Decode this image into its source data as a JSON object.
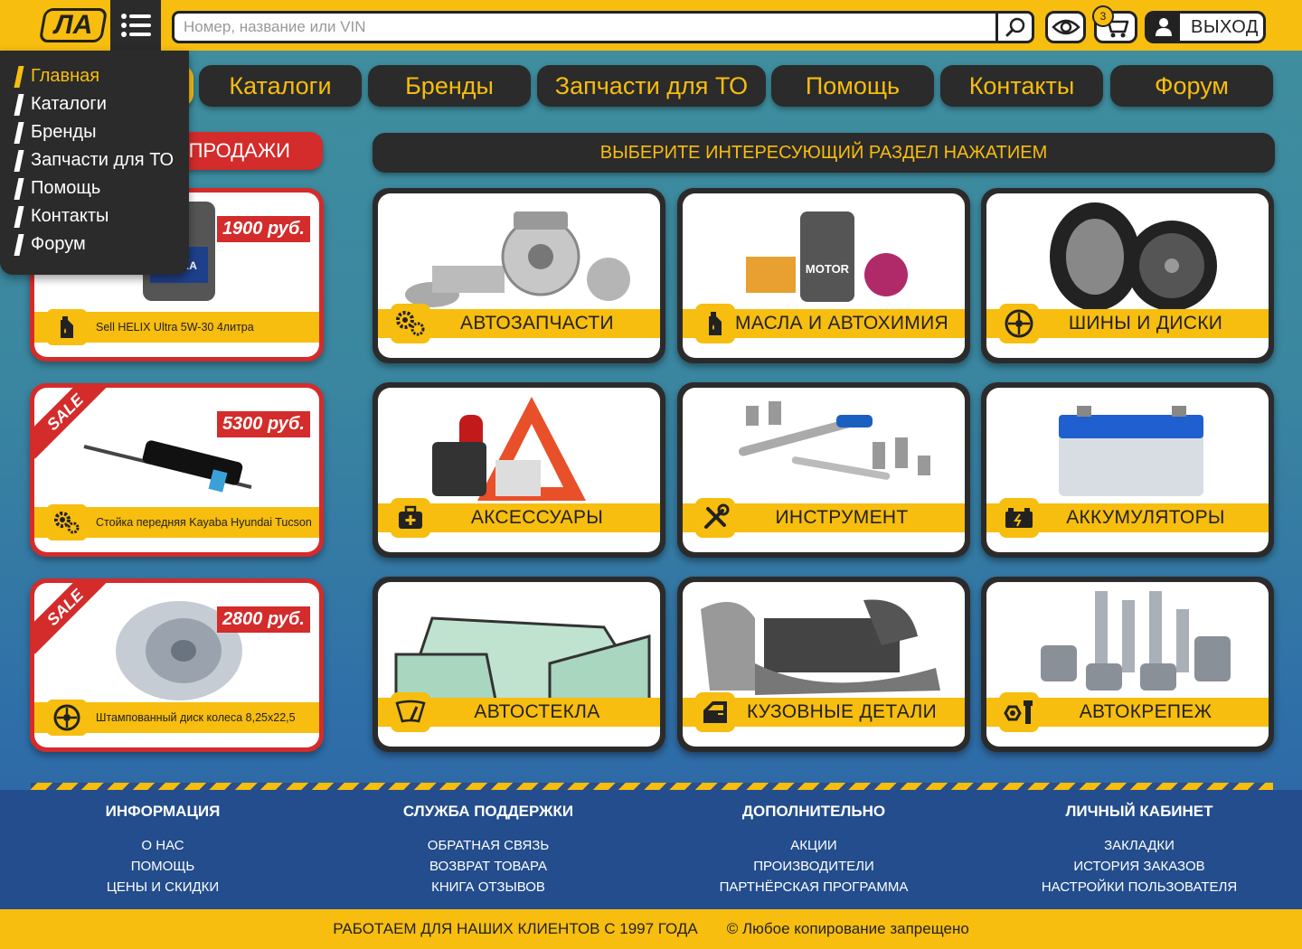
{
  "header": {
    "logo_text": "ЛА",
    "search_placeholder": "Номер, название или VIN",
    "cart_count": "3",
    "logout_label": "ВЫХОД"
  },
  "nav": {
    "items": [
      "Каталоги",
      "Бренды",
      "Запчасти для ТО",
      "Помощь",
      "Контакты",
      "Форум"
    ]
  },
  "dropdown": {
    "items": [
      "Главная",
      "Каталоги",
      "Бренды",
      "Запчасти для ТО",
      "Помощь",
      "Контакты",
      "Форум"
    ]
  },
  "sales": {
    "title": "РАСПРОДАЖИ",
    "items": [
      {
        "price": "1900 руб.",
        "name": "Sell HELIX Ultra 5W-30 4литра",
        "icon": "oil-can-icon"
      },
      {
        "price": "5300 руб.",
        "name": "Стойка передняя Kayaba Hyundai Tucson",
        "icon": "gears-icon",
        "badge": "SALE"
      },
      {
        "price": "2800 руб.",
        "name": "Штампованный диск колеса 8,25x22,5",
        "icon": "wheel-icon",
        "badge": "SALE"
      }
    ]
  },
  "main": {
    "title": "ВЫБЕРИТЕ ИНТЕРЕСУЮЩИЙ РАЗДЕЛ НАЖАТИЕМ",
    "categories": [
      {
        "label": "АВТОЗАПЧАСТИ",
        "icon": "gears-icon"
      },
      {
        "label": "МАСЛА И АВТОХИМИЯ",
        "icon": "oil-can-icon"
      },
      {
        "label": "ШИНЫ И ДИСКИ",
        "icon": "wheel-icon"
      },
      {
        "label": "АКСЕССУАРЫ",
        "icon": "first-aid-kit-icon"
      },
      {
        "label": "ИНСТРУМЕНТ",
        "icon": "wrench-screwdriver-icon"
      },
      {
        "label": "АККУМУЛЯТОРЫ",
        "icon": "battery-icon"
      },
      {
        "label": "АВТОСТЕКЛА",
        "icon": "windshield-wiper-icon"
      },
      {
        "label": "КУЗОВНЫЕ ДЕТАЛИ",
        "icon": "car-door-icon"
      },
      {
        "label": "АВТОКРЕПЕЖ",
        "icon": "bolt-nut-icon"
      }
    ]
  },
  "footer": {
    "columns": [
      {
        "title": "ИНФОРМАЦИЯ",
        "links": [
          "О НАС",
          "ПОМОЩЬ",
          "ЦЕНЫ И СКИДКИ"
        ]
      },
      {
        "title": "СЛУЖБА ПОДДЕРЖКИ",
        "links": [
          "ОБРАТНАЯ СВЯЗЬ",
          "ВОЗВРАТ ТОВАРА",
          "КНИГА ОТЗЫВОВ"
        ]
      },
      {
        "title": "ДОПОЛНИТЕЛЬНО",
        "links": [
          "АКЦИИ",
          "ПРОИЗВОДИТЕЛИ",
          "ПАРТНЁРСКАЯ ПРОГРАММА"
        ]
      },
      {
        "title": "ЛИЧНЫЙ КАБИНЕТ",
        "links": [
          "ЗАКЛАДКИ",
          "ИСТОРИЯ ЗАКАЗОВ",
          "НАСТРОЙКИ ПОЛЬЗОВАТЕЛЯ"
        ]
      }
    ],
    "since": "РАБОТАЕМ ДЛЯ НАШИХ КЛИЕНТОВ С 1997 ГОДА",
    "copyright": "©  Любое копирование запрещено"
  },
  "colors": {
    "accent": "#f7bd0f",
    "dark": "#2b2b2b",
    "sale": "#d42b2b",
    "footer": "#234d8c"
  }
}
